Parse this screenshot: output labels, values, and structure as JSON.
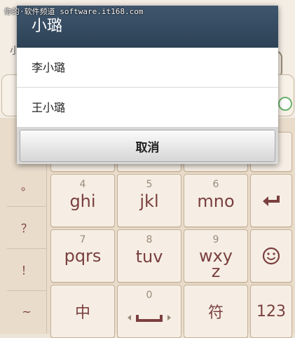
{
  "watermark": "你的·软件频道 software.it168.com",
  "background": {
    "partial_char": "小"
  },
  "dialog": {
    "title": "小璐",
    "options": [
      "李小璐",
      "王小璐"
    ],
    "cancel_label": "取消"
  },
  "keyboard": {
    "side_keys": [
      "。",
      "？",
      "！",
      "~"
    ],
    "keys": {
      "k4_num": "4",
      "k4_main": "ghi",
      "k5_num": "5",
      "k5_main": "jkl",
      "k6_num": "6",
      "k6_main": "mno",
      "k7_num": "7",
      "k7_main": "pqrs",
      "k8_num": "8",
      "k8_main": "tuv",
      "k9_num": "9",
      "k9_main": "wxyz",
      "zh": "中",
      "k0_num": "0",
      "symbol": "符",
      "num_mode": "123"
    },
    "icons": [
      "enter-icon",
      "smiley-icon",
      "space-icon"
    ]
  }
}
